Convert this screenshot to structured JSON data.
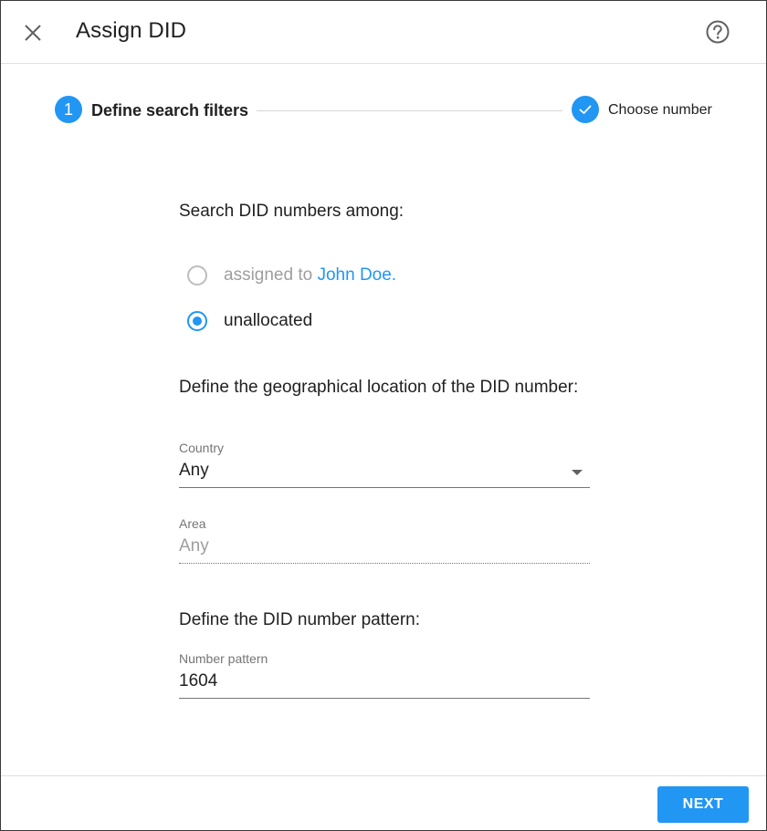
{
  "header": {
    "title": "Assign DID",
    "close_icon": "close-icon",
    "help_icon": "help-icon"
  },
  "stepper": {
    "steps": [
      {
        "number": "1",
        "label": "Define search filters",
        "active": true
      },
      {
        "label": "Choose number",
        "icon": "check-icon"
      }
    ]
  },
  "search": {
    "heading": "Search DID numbers among:",
    "options": [
      {
        "prefix": "assigned to ",
        "link": "John Doe.",
        "selected": false,
        "disabled": true
      },
      {
        "label": "unallocated",
        "selected": true
      }
    ]
  },
  "location": {
    "heading": "Define the geographical location of the DID number:",
    "country": {
      "label": "Country",
      "value": "Any"
    },
    "area": {
      "label": "Area",
      "value": "Any"
    }
  },
  "pattern": {
    "heading": "Define the DID number pattern:",
    "field": {
      "label": "Number pattern",
      "value": "1604"
    }
  },
  "footer": {
    "next_label": "NEXT"
  },
  "colors": {
    "accent": "#2196f3"
  }
}
